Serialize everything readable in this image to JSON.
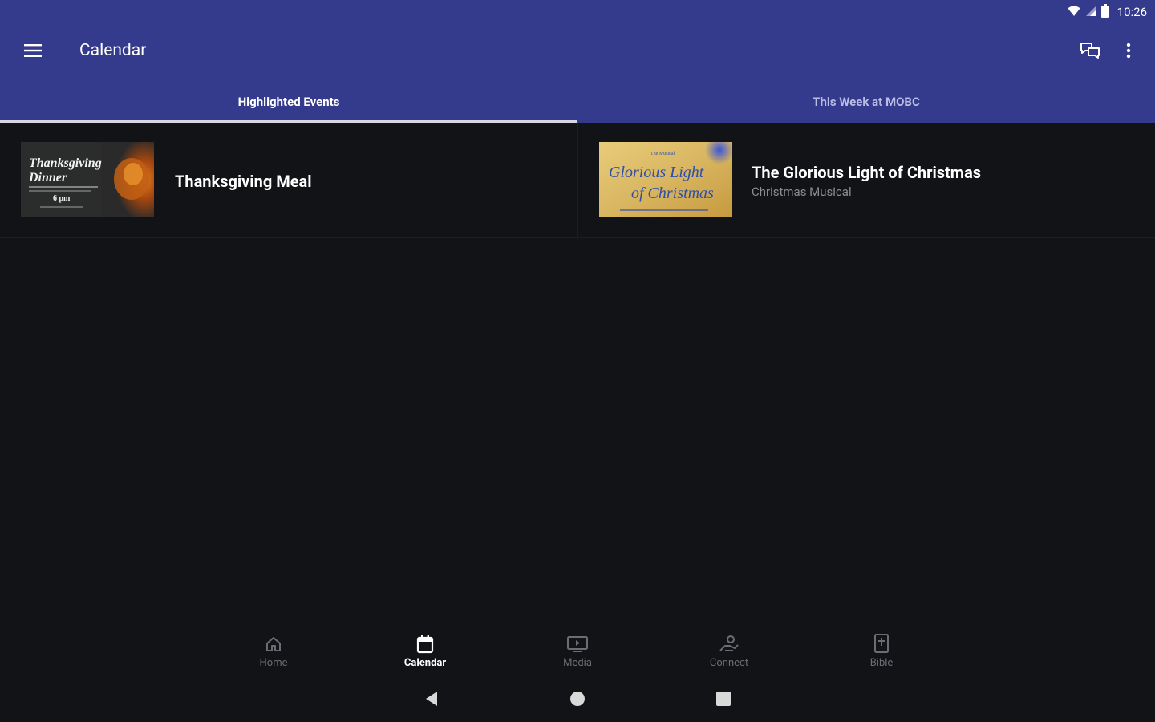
{
  "status_bar": {
    "time": "10:26",
    "icons": [
      "wifi-icon",
      "signal-icon",
      "battery-icon"
    ]
  },
  "app_bar": {
    "title": "Calendar",
    "menu_icon": "hamburger-menu-icon",
    "chat_icon": "chat-icon",
    "more_icon": "more-vert-icon"
  },
  "tabs": [
    {
      "label": "Highlighted Events",
      "active": true
    },
    {
      "label": "This Week at MOBC",
      "active": false
    }
  ],
  "events": [
    {
      "title": "Thanksgiving Meal",
      "subtitle": "",
      "thumbnail_text": [
        "Thanksgiving",
        "Dinner",
        "6 pm"
      ]
    },
    {
      "title": "The Glorious Light of Christmas",
      "subtitle": "Christmas Musical",
      "thumbnail_text": [
        "The Musical",
        "Glorious Light",
        "of Christmas"
      ]
    }
  ],
  "bottom_nav": [
    {
      "label": "Home",
      "icon": "home-icon",
      "active": false
    },
    {
      "label": "Calendar",
      "icon": "calendar-icon",
      "active": true
    },
    {
      "label": "Media",
      "icon": "media-tv-icon",
      "active": false
    },
    {
      "label": "Connect",
      "icon": "connect-hand-icon",
      "active": false
    },
    {
      "label": "Bible",
      "icon": "bible-icon",
      "active": false
    }
  ],
  "system_nav": [
    "back-icon",
    "home-circle-icon",
    "recents-icon"
  ],
  "colors": {
    "primary": "#343a8c",
    "background": "#121316",
    "indicator": "#d9d9e6",
    "inactive_tab_text": "#b9bde6",
    "muted_text": "#8b8d92"
  }
}
